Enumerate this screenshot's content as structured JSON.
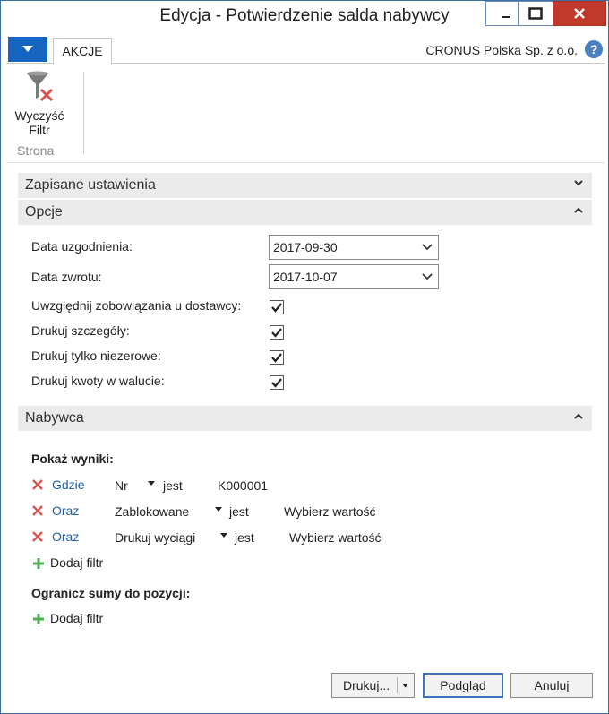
{
  "window": {
    "title": "Edycja - Potwierdzenie salda nabywcy"
  },
  "ribbon": {
    "tab_label": "AKCJE",
    "company": "CRONUS Polska Sp. z o.o.",
    "help_glyph": "?",
    "clear_filter_label_line1": "Wyczyść",
    "clear_filter_label_line2": "Filtr",
    "group_label": "Strona"
  },
  "sections": {
    "saved_settings": "Zapisane ustawienia",
    "options": "Opcje",
    "customer": "Nabywca"
  },
  "options": {
    "fields": [
      {
        "label": "Data uzgodnienia:",
        "value": "2017-09-30"
      },
      {
        "label": "Data zwrotu:",
        "value": "2017-10-07"
      }
    ],
    "checkboxes": [
      {
        "label": "Uwzględnij zobowiązania u dostawcy:",
        "checked": true
      },
      {
        "label": "Drukuj szczegóły:",
        "checked": true
      },
      {
        "label": "Drukuj tylko niezerowe:",
        "checked": true
      },
      {
        "label": "Drukuj kwoty w walucie:",
        "checked": true
      }
    ]
  },
  "customer": {
    "show_results_label": "Pokaż wyniki:",
    "filters": [
      {
        "keyword": "Gdzie",
        "field": "Nr",
        "operator": "jest",
        "value": "K000001"
      },
      {
        "keyword": "Oraz",
        "field": "Zablokowane",
        "operator": "jest",
        "value": "Wybierz wartość"
      },
      {
        "keyword": "Oraz",
        "field": "Drukuj wyciągi",
        "operator": "jest",
        "value": "Wybierz wartość"
      }
    ],
    "add_filter_label": "Dodaj filtr",
    "limit_totals_label": "Ogranicz sumy do pozycji:",
    "add_filter_label_2": "Dodaj filtr"
  },
  "footer": {
    "print_label": "Drukuj...",
    "preview_label": "Podgląd",
    "cancel_label": "Anuluj"
  },
  "colors": {
    "accent": "#1565c0",
    "close": "#c0392b",
    "link": "#1f5fa8",
    "remove_x": "#d9534f",
    "add_plus": "#4caf50"
  }
}
